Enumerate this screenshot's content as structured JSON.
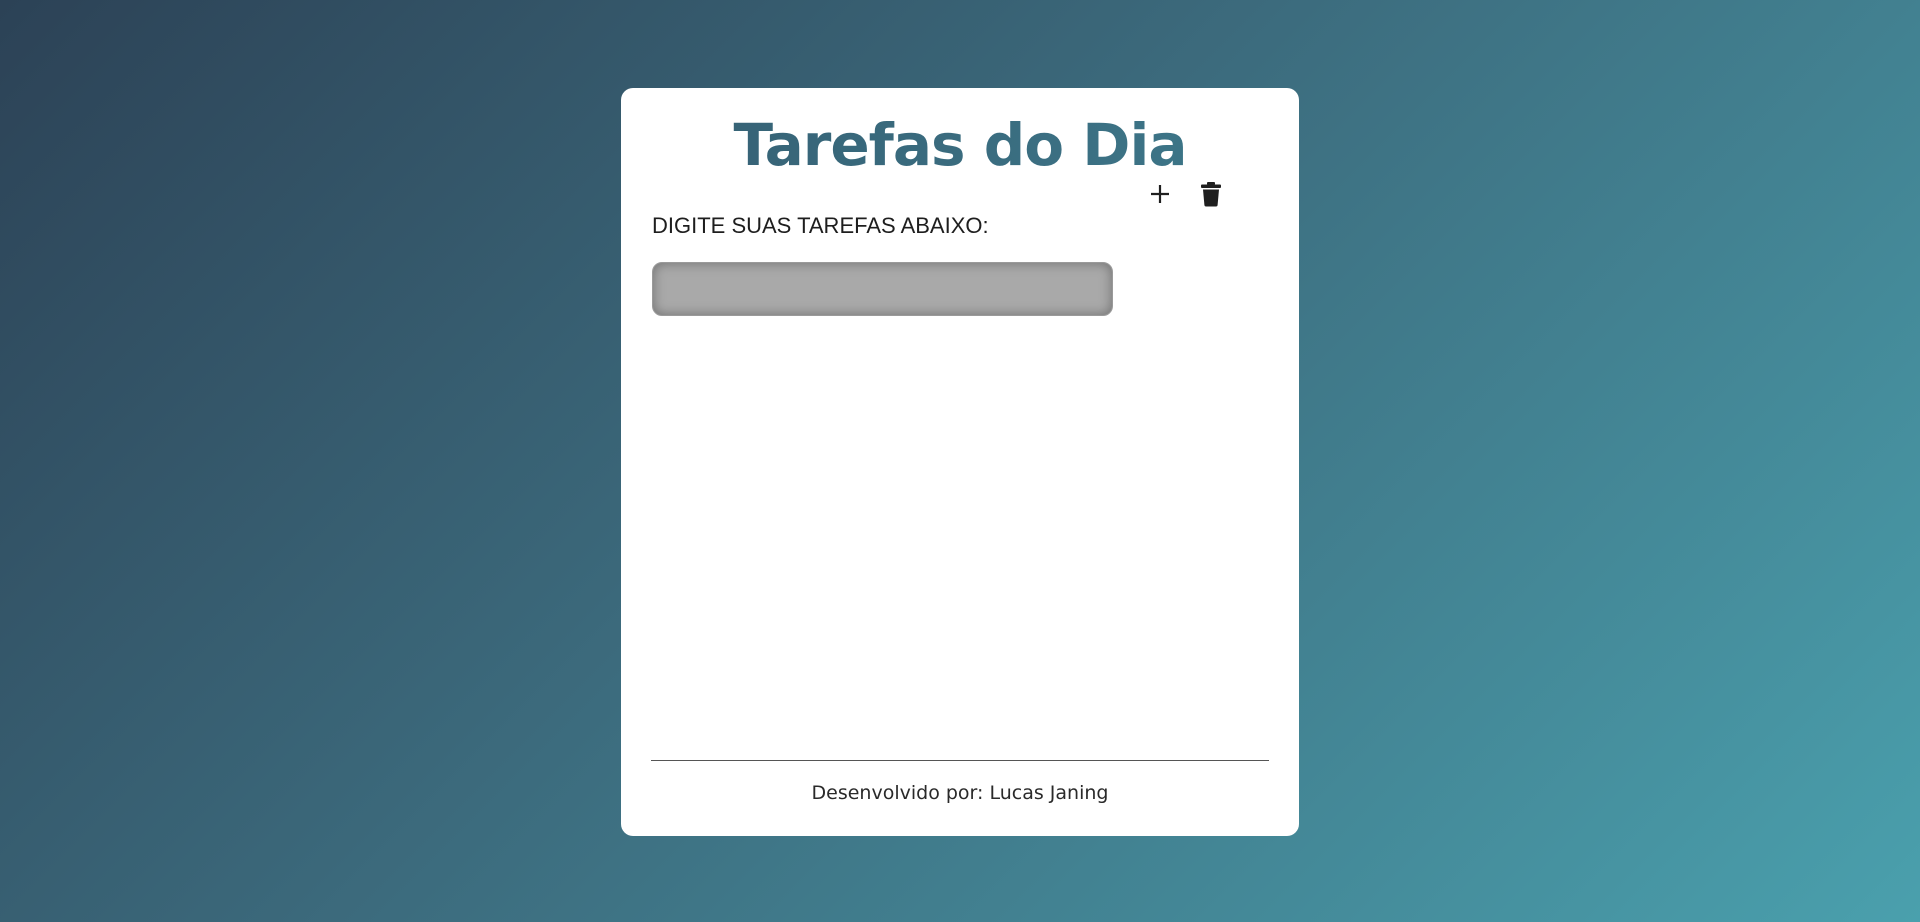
{
  "header": {
    "title": "Tarefas do Dia"
  },
  "form": {
    "prompt_label": "DIGITE SUAS TAREFAS ABAIXO:",
    "input_value": "",
    "input_placeholder": "",
    "add_icon": "plus-icon",
    "delete_icon": "trash-icon"
  },
  "tasks": [],
  "footer": {
    "credit": "Desenvolvido por: Lucas Janing"
  },
  "colors": {
    "title_gradient_start": "#2d4a5e",
    "title_gradient_end": "#4292a0",
    "background_start": "#2c4256",
    "background_end": "#4aa0ad"
  }
}
